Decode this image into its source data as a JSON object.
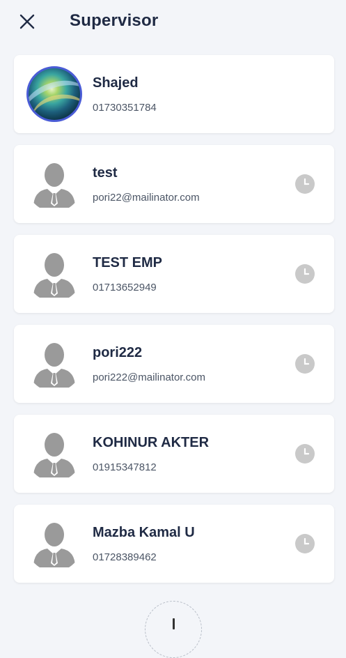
{
  "header": {
    "title": "Supervisor",
    "close_icon": "close-icon"
  },
  "supervisors": [
    {
      "name": "Shajed",
      "detail": "01730351784",
      "avatar": "photo",
      "status_icon": ""
    },
    {
      "name": "test",
      "detail": "pori22@mailinator.com",
      "avatar": "default-user",
      "status_icon": "clock-icon"
    },
    {
      "name": "TEST EMP",
      "detail": "01713652949",
      "avatar": "default-user",
      "status_icon": "clock-icon"
    },
    {
      "name": "pori222",
      "detail": "pori222@mailinator.com",
      "avatar": "default-user",
      "status_icon": "clock-icon"
    },
    {
      "name": "KOHINUR AKTER",
      "detail": "01915347812",
      "avatar": "default-user",
      "status_icon": "clock-icon"
    },
    {
      "name": "Mazba Kamal U",
      "detail": "01728389462",
      "avatar": "default-user",
      "status_icon": "clock-icon"
    }
  ],
  "colors": {
    "background": "#f3f5f9",
    "text_primary": "#1f2a44",
    "avatar_ring": "#4a5cd6",
    "placeholder_gray": "#9a9a9a",
    "status_gray": "#c9c9c9"
  },
  "fab": {
    "icon": "add-icon"
  }
}
